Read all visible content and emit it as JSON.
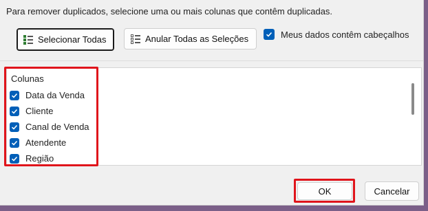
{
  "instruction": "Para remover duplicados, selecione uma ou mais colunas que contêm duplicadas.",
  "buttons": {
    "select_all": {
      "label": "Selecionar Todas",
      "icon": "select-all-icon"
    },
    "unselect_all": {
      "label": "Anular Todas as Seleções",
      "icon": "unselect-all-icon"
    },
    "ok": "OK",
    "cancel": "Cancelar"
  },
  "headers_checkbox": {
    "label": "Meus dados contêm cabeçalhos",
    "checked": true
  },
  "columns": {
    "header": "Colunas",
    "items": [
      {
        "label": "Data da Venda",
        "checked": true
      },
      {
        "label": "Cliente",
        "checked": true
      },
      {
        "label": "Canal de Venda",
        "checked": true
      },
      {
        "label": "Atendente",
        "checked": true
      },
      {
        "label": "Região",
        "checked": true
      }
    ]
  },
  "colors": {
    "checkbox": "#005fb8",
    "highlight": "#e0141b",
    "dialog_bg": "#f0f0f0"
  }
}
